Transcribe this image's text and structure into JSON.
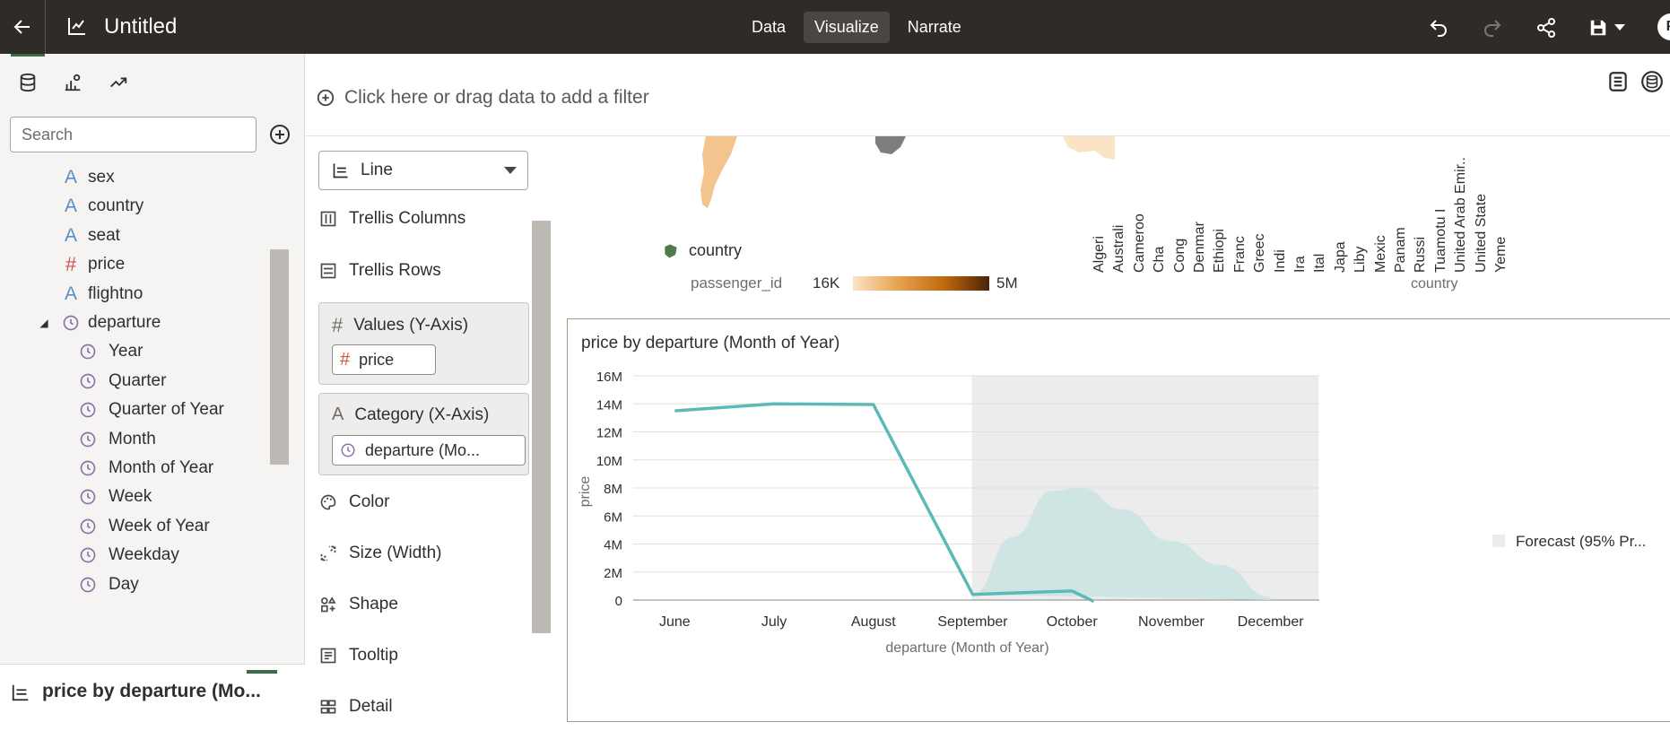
{
  "topbar": {
    "title": "Untitled",
    "tabs": [
      {
        "label": "Data",
        "active": false
      },
      {
        "label": "Visualize",
        "active": true
      },
      {
        "label": "Narrate",
        "active": false
      }
    ],
    "avatar_letter": "P",
    "icons": [
      "back-arrow-icon",
      "app-chart-icon",
      "undo-icon",
      "redo-icon",
      "share-icon",
      "save-icon",
      "chevron-down-icon"
    ]
  },
  "left_panel": {
    "tabs": [
      "data-icon",
      "visualizations-icon",
      "analytics-icon"
    ],
    "search_placeholder": "Search",
    "fields": [
      {
        "label": "sex",
        "type": "A",
        "indent": 1
      },
      {
        "label": "country",
        "type": "A",
        "indent": 1
      },
      {
        "label": "seat",
        "type": "A",
        "indent": 1
      },
      {
        "label": "price",
        "type": "#",
        "indent": 1
      },
      {
        "label": "flightno",
        "type": "A",
        "indent": 1
      },
      {
        "label": "departure",
        "type": "clock",
        "indent": 1,
        "expanded": true
      },
      {
        "label": "Year",
        "type": "clock",
        "indent": 2
      },
      {
        "label": "Quarter",
        "type": "clock",
        "indent": 2
      },
      {
        "label": "Quarter of Year",
        "type": "clock",
        "indent": 2
      },
      {
        "label": "Month",
        "type": "clock",
        "indent": 2
      },
      {
        "label": "Month of Year",
        "type": "clock",
        "indent": 2
      },
      {
        "label": "Week",
        "type": "clock",
        "indent": 2
      },
      {
        "label": "Week of Year",
        "type": "clock",
        "indent": 2
      },
      {
        "label": "Weekday",
        "type": "clock",
        "indent": 2
      },
      {
        "label": "Day",
        "type": "clock",
        "indent": 2
      }
    ],
    "footer_title": "price by departure (Mo..."
  },
  "filter_bar": {
    "placeholder": "Click here or drag data to add a filter"
  },
  "grammar": {
    "viz_type": "Line",
    "items": {
      "trellis_columns": "Trellis Columns",
      "trellis_rows": "Trellis Rows",
      "values_title": "Values (Y-Axis)",
      "values_pill": "price",
      "category_title": "Category (X-Axis)",
      "category_pill": "departure (Mo...",
      "color": "Color",
      "size": "Size (Width)",
      "shape": "Shape",
      "tooltip": "Tooltip",
      "detail": "Detail"
    }
  },
  "map_legend": {
    "country_label": "country",
    "measure_label": "passenger_id",
    "min": "16K",
    "max": "5M",
    "colors": [
      "#fbe3c5",
      "#e8a24e",
      "#c06a10",
      "#4a2307"
    ]
  },
  "country_bar": {
    "axis_title": "country",
    "ticks": [
      "Algeri",
      "Australi",
      "Cameroo",
      "Cha",
      "Cong",
      "Denmar",
      "Ethiopi",
      "Franc",
      "Greec",
      "Indi",
      "Ira",
      "Ital",
      "Japa",
      "Liby",
      "Mexic",
      "Panam",
      "Russi",
      "Tuamotu I",
      "United Arab Emir..",
      "United State",
      "Yeme"
    ]
  },
  "chart_data": {
    "type": "line",
    "title": "price by departure (Month of Year)",
    "xlabel": "departure (Month of Year)",
    "ylabel": "price",
    "categories": [
      "June",
      "July",
      "August",
      "September",
      "October",
      "November",
      "December"
    ],
    "yticks": [
      "0",
      "2M",
      "4M",
      "6M",
      "8M",
      "10M",
      "12M",
      "14M",
      "16M"
    ],
    "ylim": [
      0,
      16000000
    ],
    "series": [
      {
        "values": [
          13500000,
          14000000,
          13950000,
          400000,
          650000,
          null,
          null
        ],
        "color": "#5bbab5"
      }
    ],
    "forecast": {
      "legend_label": "Forecast (95% Pr...",
      "start_category": "September",
      "band_upper": [
        {
          "x": 3,
          "y": 400000
        },
        {
          "x": 3.4,
          "y": 4500000
        },
        {
          "x": 3.8,
          "y": 7800000
        },
        {
          "x": 4.1,
          "y": 8000000
        },
        {
          "x": 4.5,
          "y": 6500000
        },
        {
          "x": 5,
          "y": 4200000
        },
        {
          "x": 5.5,
          "y": 2500000
        },
        {
          "x": 6,
          "y": 200000
        }
      ],
      "band_lower": [
        {
          "x": 3,
          "y": 400000
        },
        {
          "x": 6,
          "y": 0
        }
      ],
      "mean_tail": [
        {
          "x": 4,
          "y": 650000
        },
        {
          "x": 4.22,
          "y": -100000
        }
      ],
      "band_color": "#cfe5e3",
      "shade_color": "#ececec"
    },
    "grid": true,
    "legend_position": "right"
  }
}
